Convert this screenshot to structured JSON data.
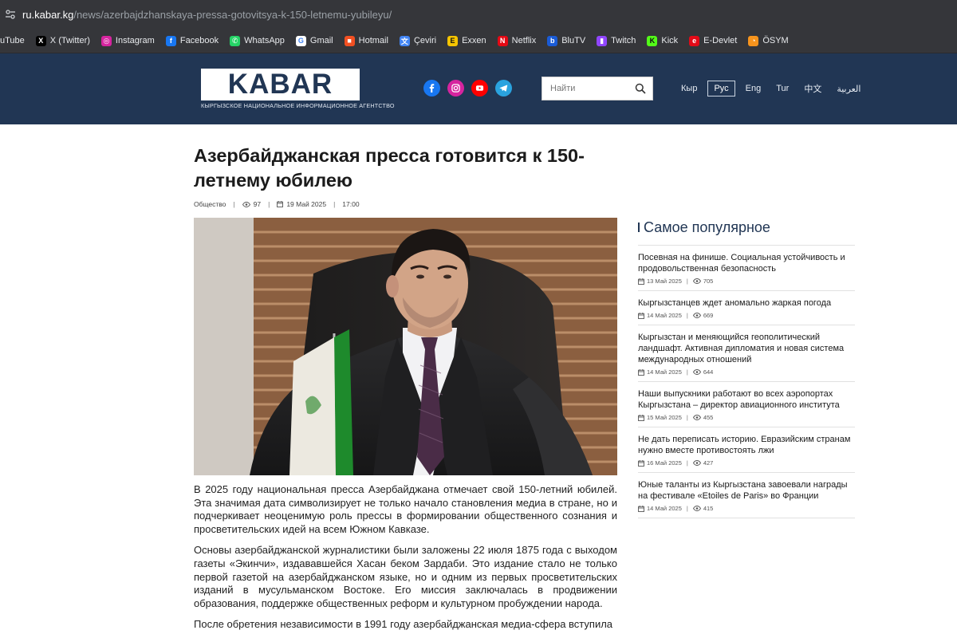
{
  "browser": {
    "url_host": "ru.kabar.kg",
    "url_path": "/news/azerbajdzhanskaya-pressa-gotovitsya-k-150-letnemu-yubileyu/",
    "bookmarks": [
      {
        "label": "uTube",
        "icon": "youtube-icon",
        "color": "#ff0000"
      },
      {
        "label": "X (Twitter)",
        "icon": "x-icon",
        "color": "#000000"
      },
      {
        "label": "Instagram",
        "icon": "instagram-icon",
        "color": "#d6249f"
      },
      {
        "label": "Facebook",
        "icon": "facebook-icon",
        "color": "#1877f2"
      },
      {
        "label": "WhatsApp",
        "icon": "whatsapp-icon",
        "color": "#25d366"
      },
      {
        "label": "Gmail",
        "icon": "google-icon",
        "color": "#ffffff"
      },
      {
        "label": "Hotmail",
        "icon": "microsoft-icon",
        "color": "#f25022"
      },
      {
        "label": "Çeviri",
        "icon": "translate-icon",
        "color": "#4285f4"
      },
      {
        "label": "Exxen",
        "icon": "exxen-icon",
        "color": "#f5c400"
      },
      {
        "label": "Netflix",
        "icon": "netflix-icon",
        "color": "#e50914"
      },
      {
        "label": "BluTV",
        "icon": "blutv-icon",
        "color": "#1a5bd6"
      },
      {
        "label": "Twitch",
        "icon": "twitch-icon",
        "color": "#9146ff"
      },
      {
        "label": "Kick",
        "icon": "kick-icon",
        "color": "#53fc18"
      },
      {
        "label": "E-Devlet",
        "icon": "edevlet-icon",
        "color": "#e30a17"
      },
      {
        "label": "ÖSYM",
        "icon": "osym-icon",
        "color": "#f7941d"
      }
    ]
  },
  "header": {
    "logo_text": "KABAR",
    "logo_subtitle": "Кыргызское национальное информационное агентство",
    "search_placeholder": "Найти",
    "socials": [
      {
        "name": "facebook-icon",
        "color": "#1877f2"
      },
      {
        "name": "instagram-icon",
        "color": "#d6249f"
      },
      {
        "name": "youtube-icon",
        "color": "#ff0000"
      },
      {
        "name": "telegram-icon",
        "color": "#2aa3df"
      }
    ],
    "languages": [
      "Кыр",
      "Рус",
      "Eng",
      "Tur",
      "中文",
      "العربية"
    ],
    "active_language": "Рус",
    "brand_color": "#213654"
  },
  "article": {
    "title": "Азербайджанская пресса готовится к 150-летнему юбилею",
    "category": "Общество",
    "views": "97",
    "date": "19 Май 2025",
    "time": "17:00",
    "paragraphs": [
      "В 2025 году национальная пресса Азербайджана отмечает свой 150-летний юбилей. Эта значимая дата символизирует не только начало становления медиа в стране, но и подчеркивает неоценимую роль прессы в формировании общественного сознания и просветительских идей на всем Южном Кавказе.",
      "Основы азербайджанской журналистики были заложены 22 июля 1875 года с выходом газеты «Экинчи», издававшейся Хасан беком Зардаби. Это издание стало не только первой газетой на азербайджанском языке, но и одним из первых просветительских изданий в мусульманском Востоке. Его миссия заключалась в продвижении образования, поддержке общественных реформ и культурном пробуждении народа.",
      "После обретения независимости в 1991 году азербайджанская медиа-сфера вступила"
    ]
  },
  "sidebar": {
    "title": "Самое популярное",
    "items": [
      {
        "title": "Посевная на финише. Социальная устойчивость и продовольственная безопасность",
        "date": "13 Май 2025",
        "views": "705"
      },
      {
        "title": "Кыргызстанцев ждет аномально жаркая погода",
        "date": "14 Май 2025",
        "views": "669"
      },
      {
        "title": "Кыргызстан и меняющийся геополитический ландшафт. Активная дипломатия и новая система международных отношений",
        "date": "14 Май 2025",
        "views": "644"
      },
      {
        "title": "Наши выпускники работают во всех аэропортах Кыргызстана – директор авиационного института",
        "date": "15 Май 2025",
        "views": "455"
      },
      {
        "title": "Не дать переписать историю. Евразийским странам нужно вместе противостоять лжи",
        "date": "16 Май 2025",
        "views": "427"
      },
      {
        "title": "Юные таланты из Кыргызстана завоевали награды на фестивале «Etoiles de Paris» во Франции",
        "date": "14 Май 2025",
        "views": "415"
      }
    ]
  }
}
